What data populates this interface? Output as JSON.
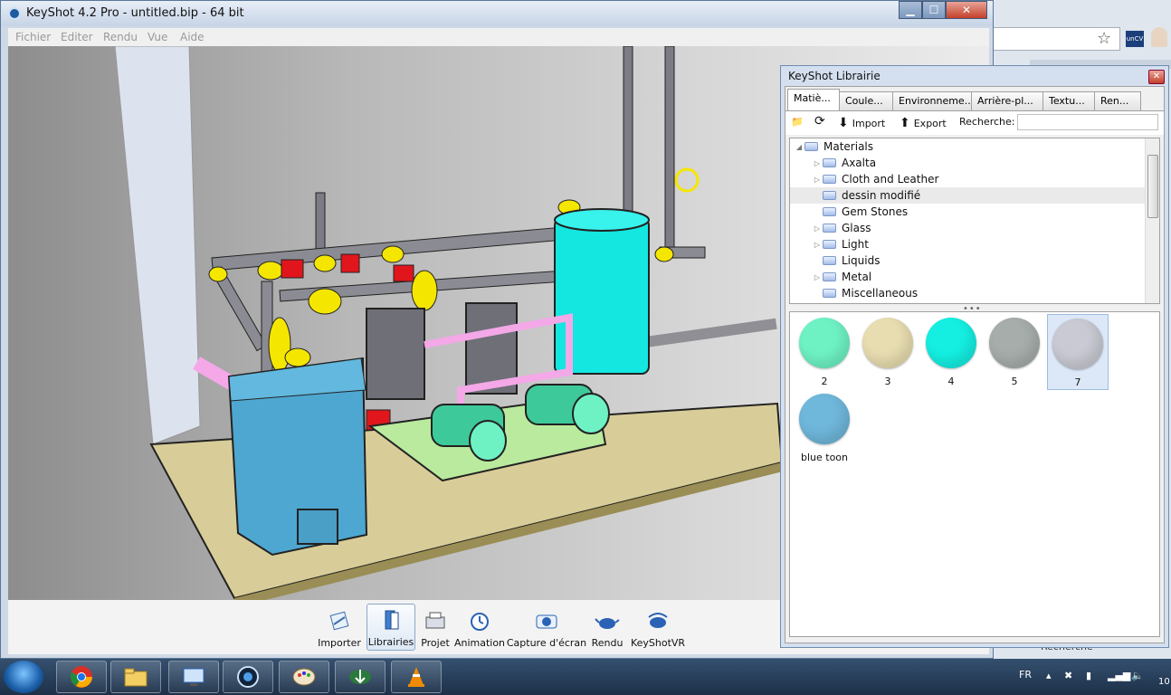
{
  "window": {
    "title": "KeyShot 4.2 Pro  - untitled.bip  - 64 bit"
  },
  "menu": [
    "Fichier",
    "Editer",
    "Rendu",
    "Vue",
    "Aide"
  ],
  "toolbar": [
    {
      "label": "Importer",
      "icon": "import-icon"
    },
    {
      "label": "Librairies",
      "icon": "library-icon",
      "active": true
    },
    {
      "label": "Projet",
      "icon": "project-icon"
    },
    {
      "label": "Animation",
      "icon": "animation-icon"
    },
    {
      "label": "Capture d'écran",
      "icon": "camera-icon"
    },
    {
      "label": "Rendu",
      "icon": "teapot-icon"
    },
    {
      "label": "KeyShotVR",
      "icon": "keyshotvr-icon"
    }
  ],
  "library": {
    "title": "KeyShot Librairie",
    "tabs": [
      "Matiè...",
      "Coule...",
      "Environneme...",
      "Arrière-pl...",
      "Textu...",
      "Ren..."
    ],
    "tools": {
      "import": "Import",
      "export": "Export",
      "search_label": "Recherche:",
      "search_value": ""
    },
    "tree": [
      {
        "label": "Materials",
        "level": 0,
        "expanded": true
      },
      {
        "label": "Axalta",
        "level": 1,
        "has_children": true
      },
      {
        "label": "Cloth and Leather",
        "level": 1,
        "has_children": true
      },
      {
        "label": "dessin modifié",
        "level": 1,
        "selected": true
      },
      {
        "label": "Gem Stones",
        "level": 1
      },
      {
        "label": "Glass",
        "level": 1,
        "has_children": true
      },
      {
        "label": "Light",
        "level": 1,
        "has_children": true
      },
      {
        "label": "Liquids",
        "level": 1
      },
      {
        "label": "Metal",
        "level": 1,
        "has_children": true
      },
      {
        "label": "Miscellaneous",
        "level": 1
      }
    ],
    "materials": [
      {
        "label": "2",
        "color": "#6ef2c4"
      },
      {
        "label": "3",
        "color": "#e8ddb0"
      },
      {
        "label": "4",
        "color": "#14efe2"
      },
      {
        "label": "5",
        "color": "#a6adaa"
      },
      {
        "label": "7",
        "color": "#c9cad3",
        "selected": true
      },
      {
        "label": "blue toon",
        "color": "#6fb7db"
      }
    ]
  },
  "background_browser": {
    "search_text": "Recherche"
  },
  "taskbar": {
    "language": "FR",
    "clock": "10"
  }
}
